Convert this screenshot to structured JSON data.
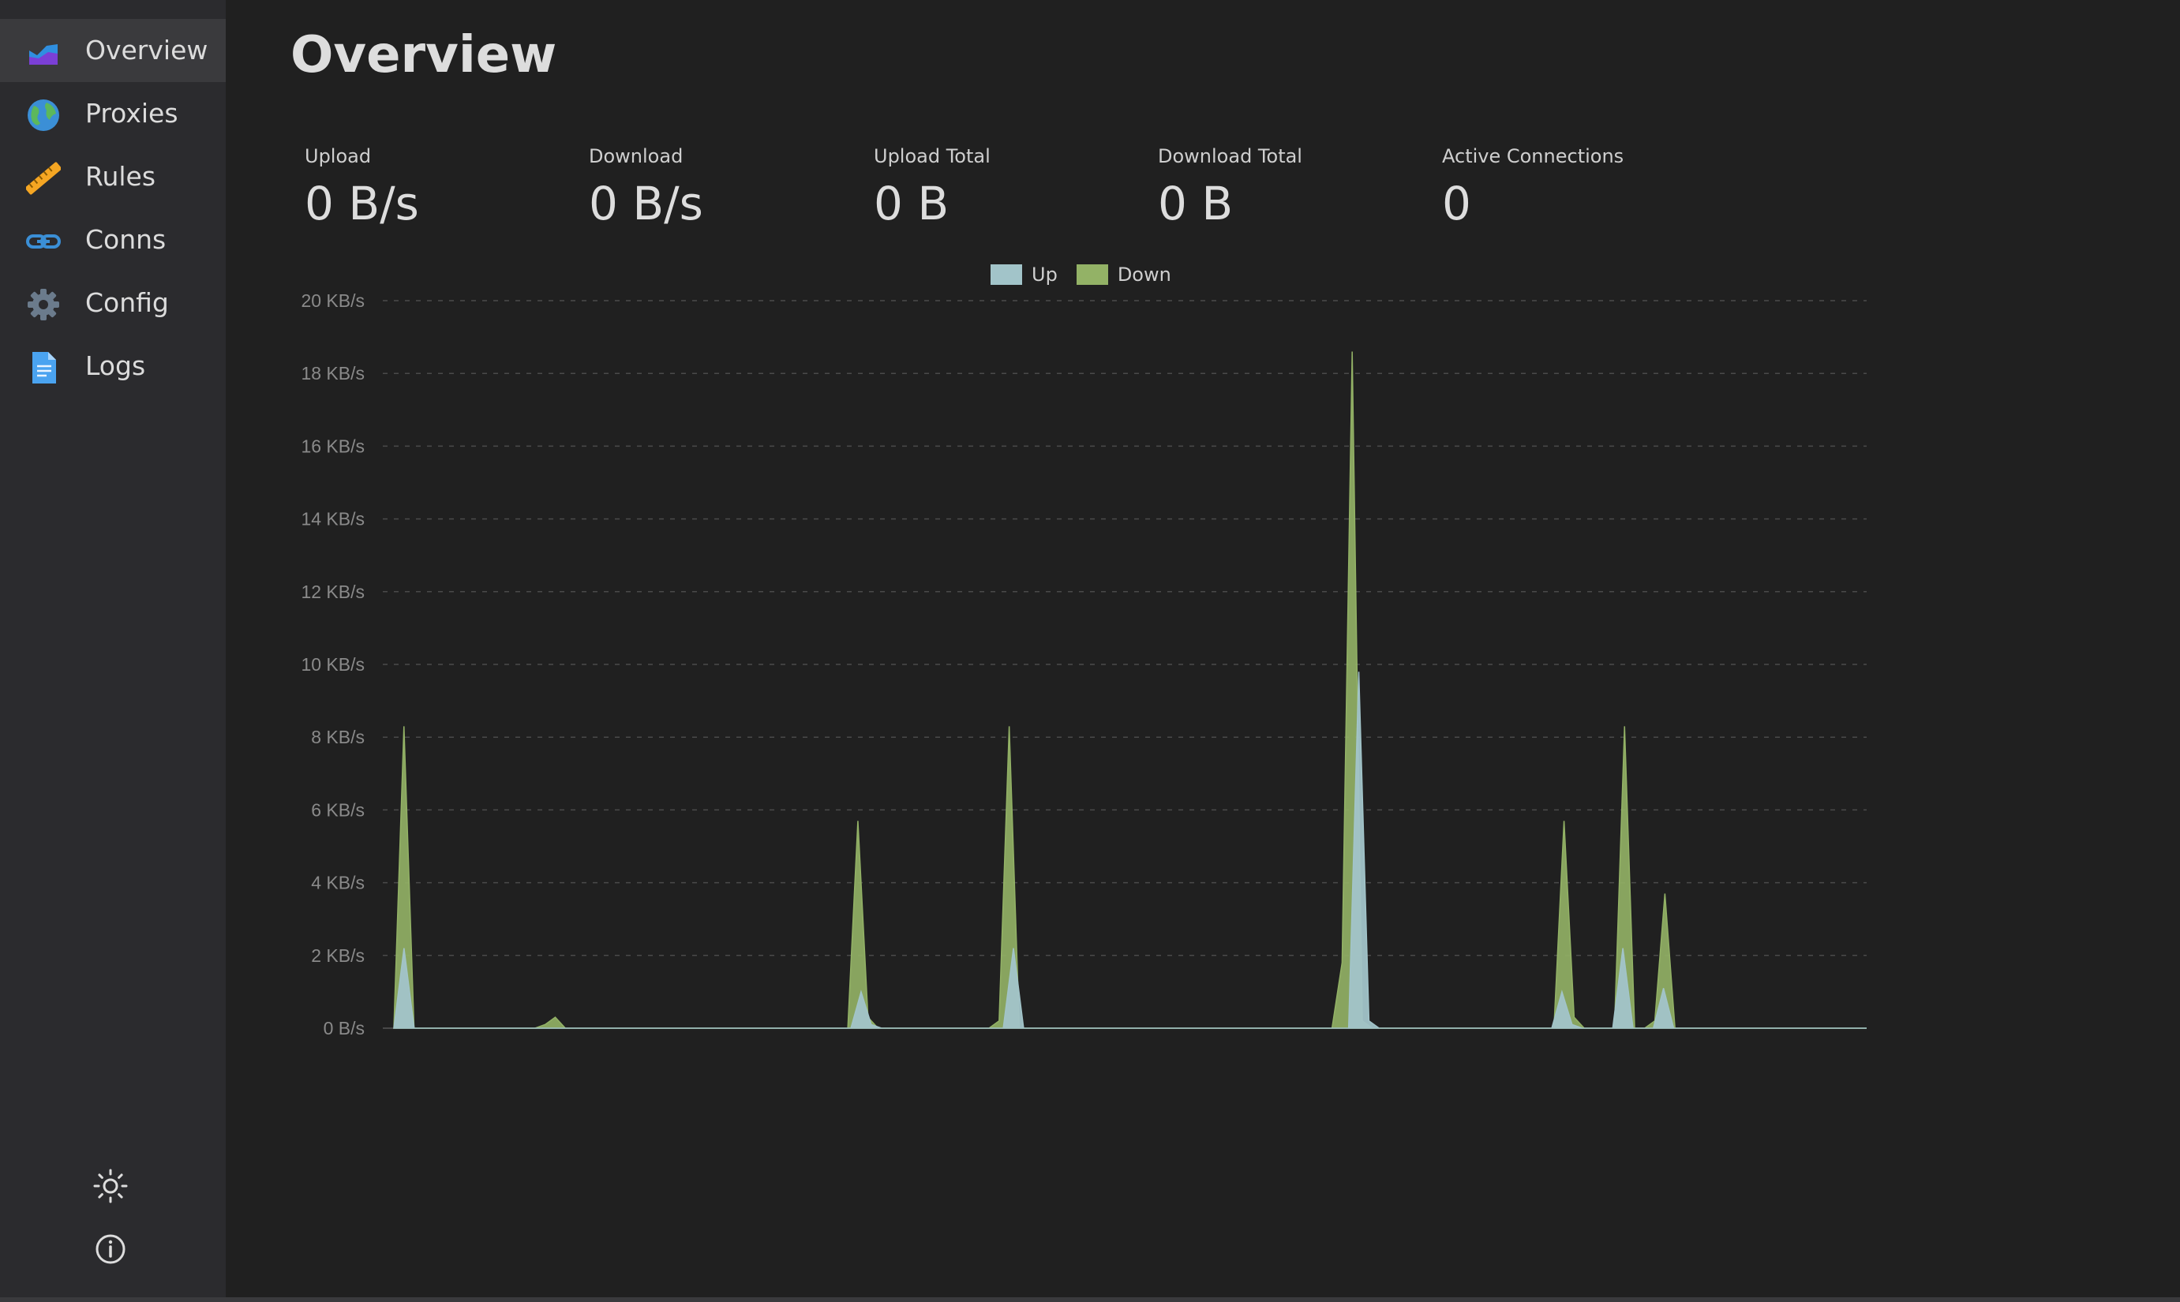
{
  "sidebar": {
    "items": [
      {
        "label": "Overview",
        "icon": "chart-area-icon",
        "active": true
      },
      {
        "label": "Proxies",
        "icon": "globe-icon",
        "active": false
      },
      {
        "label": "Rules",
        "icon": "ruler-icon",
        "active": false
      },
      {
        "label": "Conns",
        "icon": "link-icon",
        "active": false
      },
      {
        "label": "Config",
        "icon": "gear-icon",
        "active": false
      },
      {
        "label": "Logs",
        "icon": "document-icon",
        "active": false
      }
    ],
    "theme_toggle_icon": "sun-icon",
    "about_icon": "info-icon"
  },
  "page": {
    "title": "Overview"
  },
  "stats": [
    {
      "label": "Upload",
      "value": "0 B/s"
    },
    {
      "label": "Download",
      "value": "0 B/s"
    },
    {
      "label": "Upload Total",
      "value": "0 B"
    },
    {
      "label": "Download Total",
      "value": "0 B"
    },
    {
      "label": "Active Connections",
      "value": "0"
    }
  ],
  "colors": {
    "up": "#a2c4c9",
    "down": "#93b266",
    "background": "#202020",
    "sidebar": "#2b2b2e"
  },
  "chart_data": {
    "type": "area",
    "grid": true,
    "legend_position": "top-center",
    "ylim": [
      0,
      20
    ],
    "y_ticks": [
      "0 B/s",
      "2 KB/s",
      "4 KB/s",
      "6 KB/s",
      "8 KB/s",
      "10 KB/s",
      "12 KB/s",
      "14 KB/s",
      "16 KB/s",
      "18 KB/s",
      "20 KB/s"
    ],
    "series": [
      {
        "name": "Up",
        "values": [
          0,
          2.2,
          0,
          0,
          0,
          0,
          0,
          0,
          0,
          0,
          0,
          0,
          0,
          0,
          0,
          0,
          0,
          0,
          0,
          0,
          0,
          0,
          0,
          0,
          0,
          0,
          0,
          0,
          0,
          0,
          0,
          0,
          0,
          0,
          0,
          0,
          0,
          0,
          0,
          0,
          0,
          0,
          0,
          0,
          0,
          0,
          1.0,
          0.1,
          0,
          0,
          0,
          0,
          0,
          0,
          0,
          0,
          0,
          0,
          0,
          0,
          0,
          2.2,
          0,
          0,
          0,
          0,
          0,
          0,
          0,
          0,
          0,
          0,
          0,
          0,
          0,
          0,
          0,
          0,
          0,
          0,
          0,
          0,
          0,
          0,
          0,
          0,
          0,
          0,
          0,
          0,
          0,
          0,
          0,
          0,
          0,
          9.8,
          0.2,
          0,
          0,
          0,
          0,
          0,
          0,
          0,
          0,
          0,
          0,
          0,
          0,
          0,
          0,
          0,
          0,
          0,
          0,
          1.0,
          0.1,
          0,
          0,
          0,
          0,
          2.2,
          0,
          0,
          0,
          1.1,
          0,
          0,
          0,
          0,
          0,
          0,
          0,
          0,
          0,
          0,
          0,
          0,
          0,
          0,
          0,
          0,
          0,
          0,
          0,
          0
        ]
      },
      {
        "name": "Down",
        "values": [
          0,
          8.3,
          0,
          0,
          0,
          0,
          0,
          0,
          0,
          0,
          0,
          0,
          0,
          0,
          0,
          0.1,
          0.3,
          0,
          0,
          0,
          0,
          0,
          0,
          0,
          0,
          0,
          0,
          0,
          0,
          0,
          0,
          0,
          0,
          0,
          0,
          0,
          0,
          0,
          0,
          0,
          0,
          0,
          0,
          0,
          0,
          0,
          5.7,
          0.3,
          0,
          0,
          0,
          0,
          0,
          0,
          0,
          0,
          0,
          0,
          0,
          0,
          0.2,
          8.3,
          0,
          0,
          0,
          0,
          0,
          0,
          0,
          0,
          0,
          0,
          0,
          0,
          0,
          0,
          0,
          0,
          0,
          0,
          0,
          0,
          0,
          0,
          0,
          0,
          0,
          0,
          0,
          0,
          0,
          0,
          0,
          0,
          1.8,
          18.6,
          0.2,
          0,
          0,
          0,
          0,
          0,
          0,
          0,
          0,
          0,
          0,
          0,
          0,
          0,
          0,
          0,
          0,
          0,
          0,
          0,
          5.7,
          0.3,
          0,
          0,
          0,
          0,
          8.3,
          0,
          0,
          0.2,
          3.7,
          0,
          0,
          0,
          0,
          0,
          0,
          0,
          0,
          0,
          0,
          0,
          0,
          0,
          0,
          0,
          0,
          0,
          0,
          0,
          0
        ]
      }
    ]
  }
}
